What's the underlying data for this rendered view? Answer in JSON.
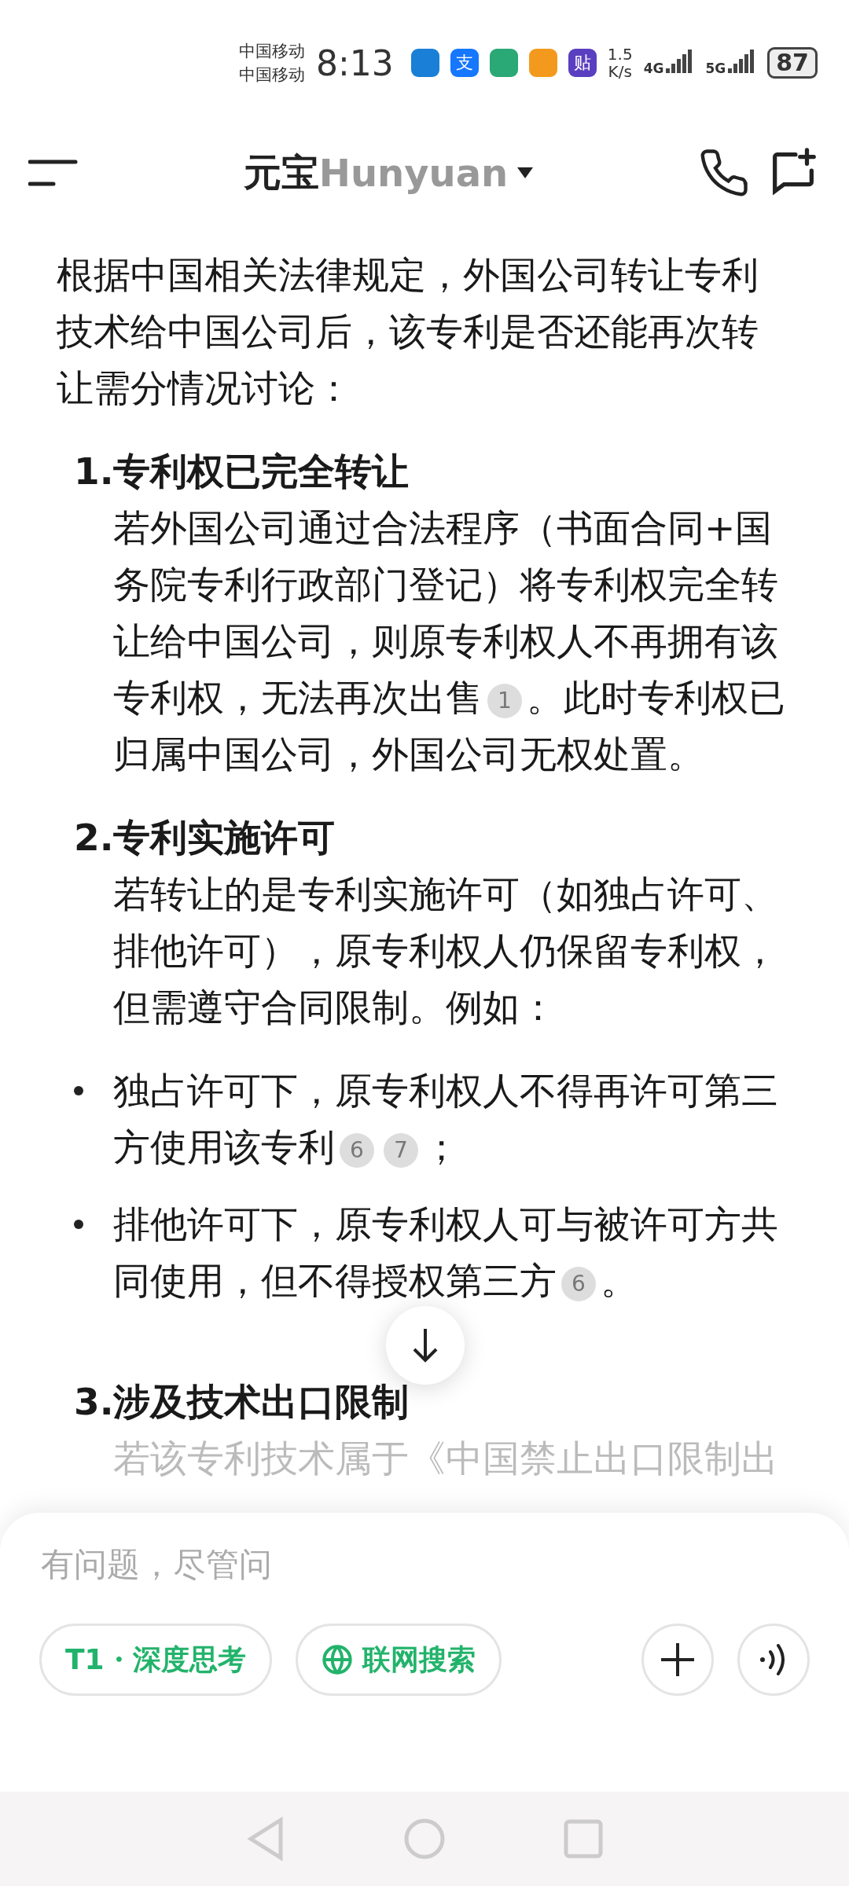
{
  "status_bar": {
    "carriers": [
      "中国移动",
      "中国移动"
    ],
    "time": "8:13",
    "apps": [
      {
        "color": "#1a7fd6"
      },
      {
        "label": "支",
        "color": "#1677ff"
      },
      {
        "color": "#2aa876"
      },
      {
        "color": "#f39a1e"
      },
      {
        "label": "贴",
        "color": "#5a3fc0"
      }
    ],
    "speed": [
      "1.5",
      "K/s"
    ],
    "networks": [
      "4G",
      "5G"
    ],
    "battery": "87"
  },
  "header": {
    "title": "元宝",
    "model": "Hunyuan"
  },
  "content": {
    "intro": "根据中国相关法律规定，外国公司转让专利技术给中国公司后，该专利是否还能再次转让需分情况讨论：",
    "items": [
      {
        "number": "1.",
        "heading": "专利权已完全转让",
        "body": [
          {
            "kind": "text",
            "text": "若外国公司通过合法程序（书面合同+国务院专利行政部门登记）将专利权完全转让给中国公司，则原专利权人不再拥有该专利权，无法再次出售"
          },
          {
            "kind": "cite",
            "text": "1"
          },
          {
            "kind": "text",
            "text": "。此时专利权已归属中国公司，外国公司无权处置。"
          }
        ]
      },
      {
        "number": "2.",
        "heading": "专利实施许可",
        "body": [
          {
            "kind": "text",
            "text": "若转让的是专利实施许可（如独占许可、排他许可），原专利权人仍保留专利权，但需遵守合同限制。例如："
          }
        ]
      }
    ],
    "bullets": [
      [
        {
          "kind": "text",
          "text": "独占许可下，原专利权人不得再许可第三方使用该专利"
        },
        {
          "kind": "cite",
          "text": "6"
        },
        {
          "kind": "cite",
          "text": "7"
        },
        {
          "kind": "text",
          "text": "；"
        }
      ],
      [
        {
          "kind": "text",
          "text": "排他许可下，原专利权人可与被许可方共同使用，但不得授权第三方"
        },
        {
          "kind": "cite",
          "text": "6"
        },
        {
          "kind": "text",
          "text": "。"
        }
      ]
    ],
    "last_item": {
      "number": "3.",
      "heading": "涉及技术出口限制",
      "body": "若该专利技术属于《中国禁止出口限制出"
    }
  },
  "composer": {
    "placeholder": "有问题，尽管问",
    "chips": [
      {
        "kind": "think",
        "label": "T1・深度思考"
      },
      {
        "kind": "web",
        "label": "联网搜索"
      }
    ]
  }
}
